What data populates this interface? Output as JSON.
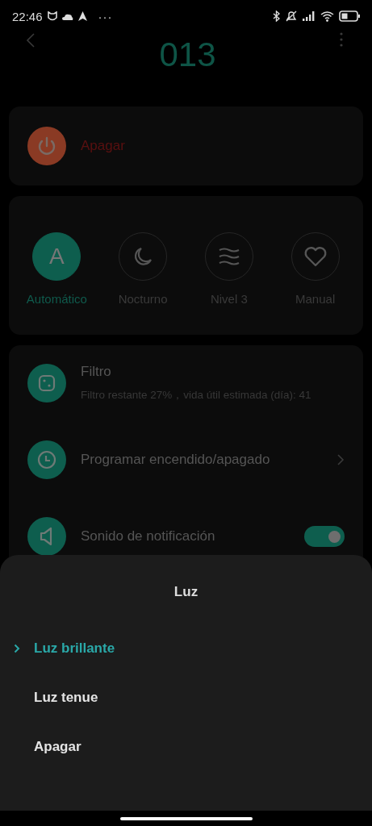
{
  "status_bar": {
    "time": "22:46",
    "more": "···"
  },
  "header": {
    "title": "013"
  },
  "power": {
    "label": "Apagar"
  },
  "modes": [
    {
      "kind": "letter",
      "glyph": "A",
      "label": "Automático",
      "selected": true
    },
    {
      "kind": "moon",
      "label": "Nocturno",
      "selected": false
    },
    {
      "kind": "waves",
      "label": "Nivel 3",
      "selected": false
    },
    {
      "kind": "heart",
      "label": "Manual",
      "selected": false
    }
  ],
  "settings": [
    {
      "kind": "info",
      "title": "Filtro",
      "subtitle": "Filtro restante 27%，vida útil estimada (día): 41"
    },
    {
      "kind": "link",
      "title": "Programar encendido/apagado"
    },
    {
      "kind": "toggle",
      "title": "Sonido de notificación",
      "on": true
    }
  ],
  "sheet": {
    "title": "Luz",
    "options": [
      {
        "label": "Luz brillante",
        "selected": true
      },
      {
        "label": "Luz tenue",
        "selected": false
      },
      {
        "label": "Apagar",
        "selected": false
      }
    ]
  }
}
